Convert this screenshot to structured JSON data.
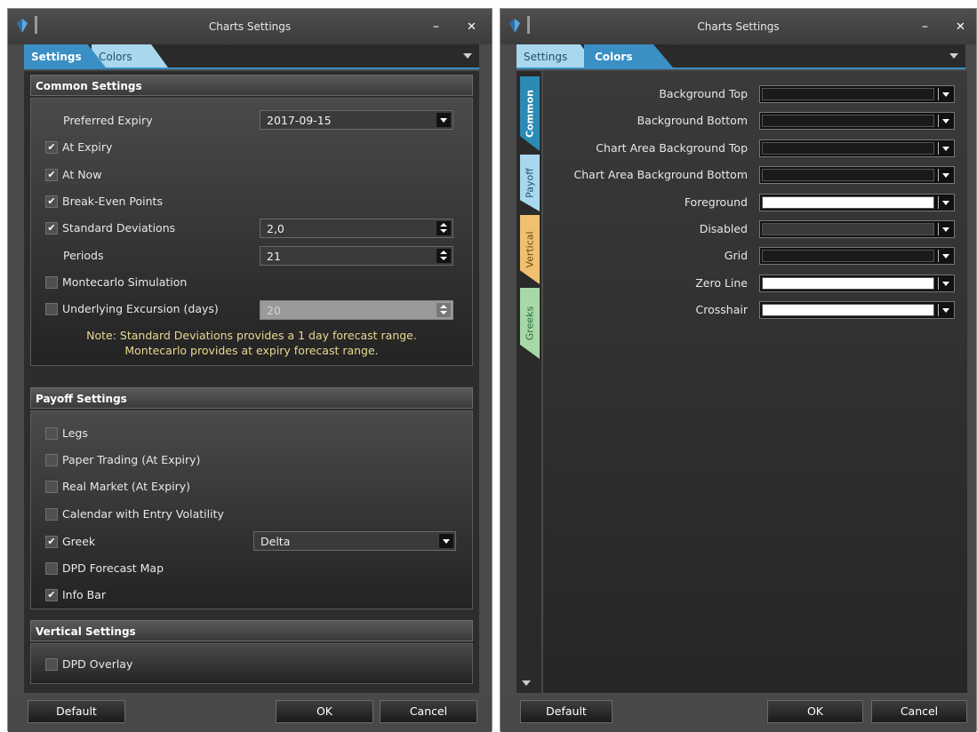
{
  "left": {
    "title": "Charts Settings",
    "minimize": "–",
    "close": "✕",
    "tabs": {
      "settings": "Settings",
      "colors": "Colors"
    },
    "common": {
      "header": "Common Settings",
      "preferred_expiry_label": "Preferred Expiry",
      "preferred_expiry_value": "2017-09-15",
      "at_expiry": "At Expiry",
      "at_now": "At Now",
      "break_even": "Break-Even Points",
      "std_dev": "Standard Deviations",
      "std_dev_value": "2,0",
      "periods": "Periods",
      "periods_value": "21",
      "montecarlo": "Montecarlo Simulation",
      "underlying_excursion": "Underlying Excursion (days)",
      "underlying_excursion_value": "20",
      "note_line1": "Note: Standard Deviations provides a 1 day forecast range.",
      "note_line2": "Montecarlo provides at expiry forecast range."
    },
    "payoff": {
      "header": "Payoff Settings",
      "legs": "Legs",
      "paper_trading": "Paper Trading (At Expiry)",
      "real_market": "Real Market (At Expiry)",
      "calendar": "Calendar with Entry Volatility",
      "greek": "Greek",
      "greek_value": "Delta",
      "dpd_forecast": "DPD Forecast Map",
      "info_bar": "Info Bar"
    },
    "vertical": {
      "header": "Vertical Settings",
      "dpd_overlay": "DPD Overlay"
    },
    "buttons": {
      "default": "Default",
      "ok": "OK",
      "cancel": "Cancel"
    },
    "checked": "✔"
  },
  "right": {
    "title": "Charts Settings",
    "minimize": "–",
    "close": "✕",
    "tabs": {
      "settings": "Settings",
      "colors": "Colors"
    },
    "vtabs": {
      "common": "Common",
      "payoff": "Payoff",
      "vertical": "Vertical",
      "greeks": "Greeks"
    },
    "colors": {
      "background_top": "Background Top",
      "background_bottom": "Background Bottom",
      "chart_area_top": "Chart Area Background Top",
      "chart_area_bottom": "Chart Area Background Bottom",
      "foreground": "Foreground",
      "disabled": "Disabled",
      "grid": "Grid",
      "zero_line": "Zero Line",
      "crosshair": "Crosshair"
    },
    "swatches": {
      "background_top": "#1a1a1a",
      "background_bottom": "#1a1a1a",
      "chart_area_top": "#1a1a1a",
      "chart_area_bottom": "#1a1a1a",
      "foreground": "#ffffff",
      "disabled": "#3a3a3a",
      "grid": "#1a1a1a",
      "zero_line": "#ffffff",
      "crosshair": "#ffffff"
    },
    "buttons": {
      "default": "Default",
      "ok": "OK",
      "cancel": "Cancel"
    }
  },
  "colors": {
    "accent": "#3a8fc4",
    "note": "#e8d890",
    "window": "#4a4a4a"
  }
}
